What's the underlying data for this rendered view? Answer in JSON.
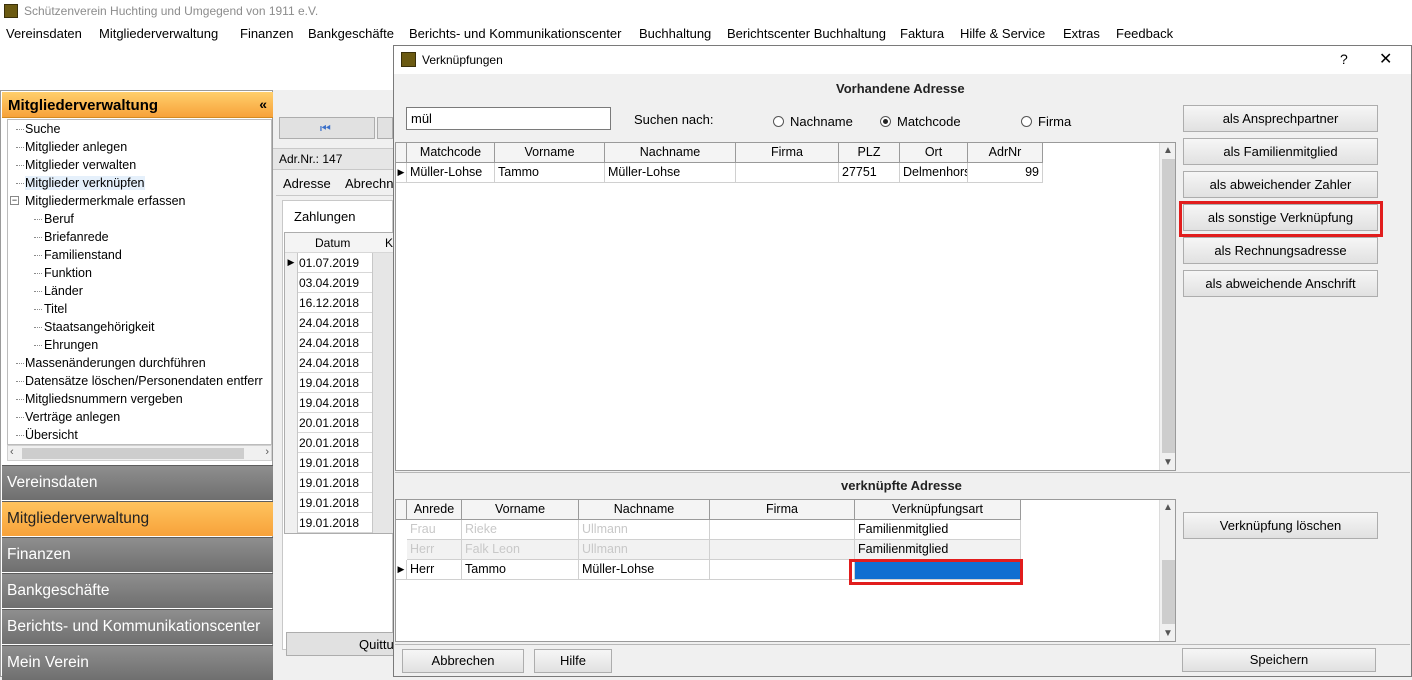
{
  "app": {
    "title": "Schützenverein Huchting und Umgegend von 1911 e.V."
  },
  "menu": [
    "Vereinsdaten",
    "Mitgliederverwaltung",
    "Finanzen",
    "Bankgeschäfte",
    "Berichts- und Kommunikationscenter",
    "Buchhaltung",
    "Berichtscenter Buchhaltung",
    "Faktura",
    "Hilfe & Service",
    "Extras",
    "Feedback"
  ],
  "sidebar": {
    "header": "Mitgliederverwaltung",
    "collapse": "«",
    "tree": [
      "Suche",
      "Mitglieder anlegen",
      "Mitglieder verwalten",
      "Mitglieder verknüpfen",
      "Mitgliedermerkmale erfassen",
      "Beruf",
      "Briefanrede",
      "Familienstand",
      "Funktion",
      "Länder",
      "Titel",
      "Staatsangehörigkeit",
      "Ehrungen",
      "Massenänderungen durchführen",
      "Datensätze löschen/Personendaten entferr",
      "Mitgliedsnummern vergeben",
      "Verträge anlegen",
      "Übersicht"
    ],
    "nav": [
      "Vereinsdaten",
      "Mitgliederverwaltung",
      "Finanzen",
      "Bankgeschäfte",
      "Berichts- und Kommunikationscenter",
      "Mein Verein"
    ]
  },
  "middle": {
    "adr": "Adr.Nr.: 147",
    "tabs": [
      "Adresse",
      "Abrechn"
    ],
    "zahlungen": "Zahlungen",
    "col_datum": "Datum",
    "col_k": "K",
    "dates": [
      "01.07.2019",
      "03.04.2019",
      "16.12.2018",
      "24.04.2018",
      "24.04.2018",
      "24.04.2018",
      "19.04.2018",
      "19.04.2018",
      "20.01.2018",
      "20.01.2018",
      "19.01.2018",
      "19.01.2018",
      "19.01.2018",
      "19.01.2018"
    ],
    "quitt": "Quittu"
  },
  "dialog": {
    "title": "Verknüpfungen",
    "help": "?",
    "close": "✕",
    "section_top": "Vorhandene Adresse",
    "search_value": "mül",
    "search_label": "Suchen nach:",
    "radios": [
      "Nachname",
      "Matchcode",
      "Firma"
    ],
    "radio_selected": "Matchcode",
    "top_columns": [
      "Matchcode",
      "Vorname",
      "Nachname",
      "Firma",
      "PLZ",
      "Ort",
      "AdrNr"
    ],
    "top_row": {
      "matchcode": "Müller-Lohse",
      "vorname": "Tammo",
      "nachname": "Müller-Lohse",
      "firma": "",
      "plz": "27751",
      "ort": "Delmenhors",
      "adrnr": "99"
    },
    "side_buttons": [
      "als Ansprechpartner",
      "als Familienmitglied",
      "als abweichender Zahler",
      "als sonstige Verknüpfung",
      "als Rechnungsadresse",
      "als abweichende Anschrift"
    ],
    "section_bottom": "verknüpfte Adresse",
    "bottom_columns": [
      "Anrede",
      "Vorname",
      "Nachname",
      "Firma",
      "Verknüpfungsart"
    ],
    "bottom_rows": [
      {
        "anrede": "Frau",
        "vorname": "Rieke",
        "nachname": "Ullmann",
        "firma": "",
        "art": "Familienmitglied"
      },
      {
        "anrede": "Herr",
        "vorname": "Falk Leon",
        "nachname": "Ullmann",
        "firma": "",
        "art": "Familienmitglied"
      },
      {
        "anrede": "Herr",
        "vorname": "Tammo",
        "nachname": "Müller-Lohse",
        "firma": "",
        "art": ""
      }
    ],
    "delete_btn": "Verknüpfung löschen",
    "cancel_btn": "Abbrechen",
    "help_btn": "Hilfe",
    "save_btn": "Speichern"
  },
  "colors": {
    "highlight": "#e11d1d",
    "accent": "#f7a23a",
    "selection": "#0f6fd1"
  }
}
